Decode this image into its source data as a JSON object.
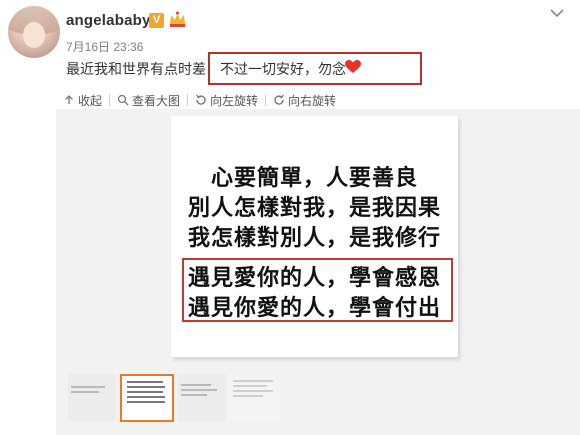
{
  "post": {
    "username": "angelababy",
    "verified_badge": "V",
    "time": "7月16日 23:36",
    "text_part1": "最近我和世界有点时差",
    "text_part2": "不过一切安好，勿念",
    "heart_icon": "red-heart-icon"
  },
  "toolbar": {
    "collapse": "收起",
    "view_large": "查看大图",
    "rotate_left": "向左旋转",
    "rotate_right": "向右旋转"
  },
  "image_text": {
    "line1": "心要簡單，人要善良",
    "line2": "別人怎樣對我，是我因果",
    "line3": "我怎樣對別人，是我修行",
    "line4": "遇見愛你的人，學會感恩",
    "line5": "遇見你愛的人，學會付出"
  },
  "colors": {
    "highlight_border": "#b5322c",
    "thumb_selected_border": "#ea7a1f",
    "verified_badge": "#f4a62a",
    "heart": "#e8322a"
  }
}
